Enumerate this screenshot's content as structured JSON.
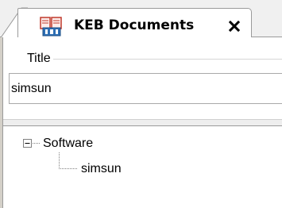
{
  "tab": {
    "title": "KEB Documents",
    "icon": "keb-document-icon",
    "close_icon": "close-icon"
  },
  "form": {
    "title_label": "Title",
    "title_value": "simsun"
  },
  "tree": {
    "root": {
      "label": "Software",
      "expanded": true,
      "children": [
        {
          "label": "simsun"
        }
      ]
    }
  },
  "colors": {
    "tab_border": "#9a9a9a",
    "icon_red": "#c0392b",
    "icon_blue": "#2e6fb5"
  }
}
